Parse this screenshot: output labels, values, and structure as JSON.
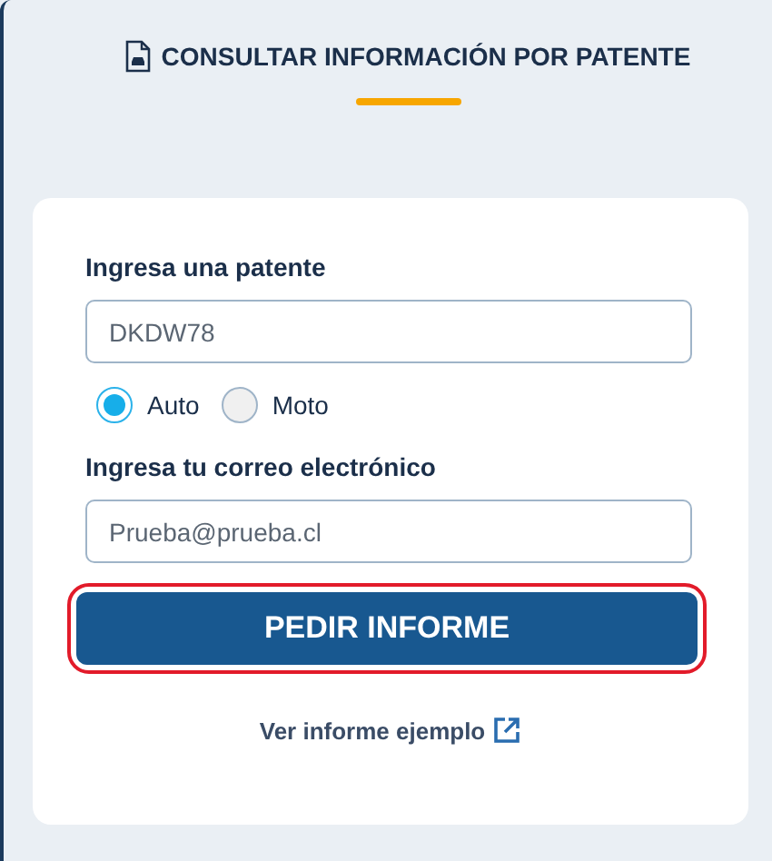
{
  "tab": {
    "label": "CONSULTAR INFORMACIÓN POR PATENTE",
    "selected": true
  },
  "form": {
    "plate_label": "Ingresa una patente",
    "plate_value": "DKDW78",
    "vehicle_types": [
      {
        "label": "Auto",
        "selected": true
      },
      {
        "label": "Moto",
        "selected": false
      }
    ],
    "email_label": "Ingresa tu correo electrónico",
    "email_value": "Prueba@prueba.cl",
    "submit": {
      "label": "PEDIR INFORME",
      "highlighted": true
    },
    "example_link": "Ver informe ejemplo"
  }
}
